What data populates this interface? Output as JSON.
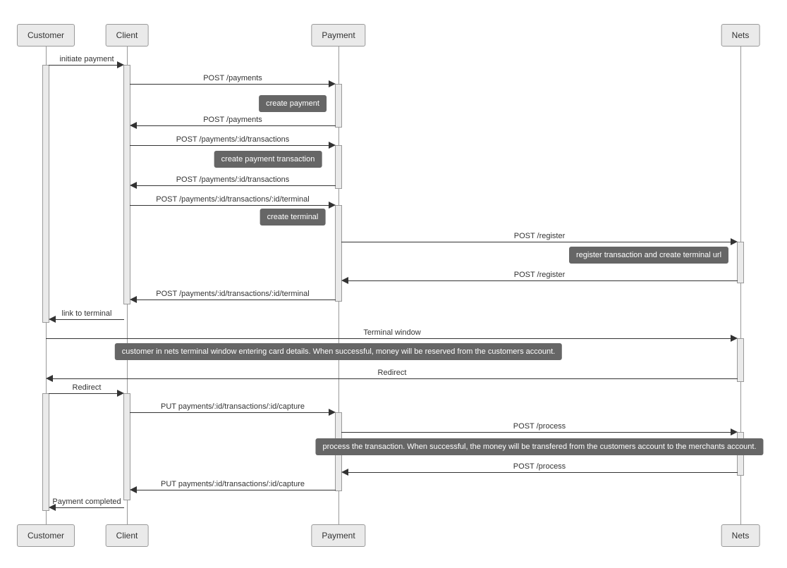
{
  "participants": {
    "customer": "Customer",
    "client": "Client",
    "payment": "Payment",
    "nets": "Nets"
  },
  "messages": {
    "m_initiate": "initiate payment",
    "m_post_pay": "POST /payments",
    "n_create_payment": "create payment",
    "m_post_pay_ret": "POST /payments",
    "m_post_tx": "POST /payments/:id/transactions",
    "n_create_tx": "create payment transaction",
    "m_post_tx_ret": "POST /payments/:id/transactions",
    "m_post_term": "POST /payments/:id/transactions/:id/terminal",
    "n_create_term": "create terminal",
    "m_register": "POST /register",
    "n_register": "register transaction and create terminal url",
    "m_register_ret": "POST /register",
    "m_post_term_ret": "POST /payments/:id/transactions/:id/terminal",
    "m_link": "link to terminal",
    "m_termwin": "Terminal window",
    "n_termwin": "customer in nets terminal window entering card details. When successful, money will be reserved from the customers account.",
    "m_redirect1": "Redirect",
    "m_redirect2": "Redirect",
    "m_put_cap": "PUT payments/:id/transactions/:id/capture",
    "m_process": "POST /process",
    "n_process": "process the transaction. When successful, the money will be transfered from the customers account to the merchants account.",
    "m_process_ret": "POST /process",
    "m_put_cap_ret": "PUT payments/:id/transactions/:id/capture",
    "m_completed": "Payment completed"
  }
}
